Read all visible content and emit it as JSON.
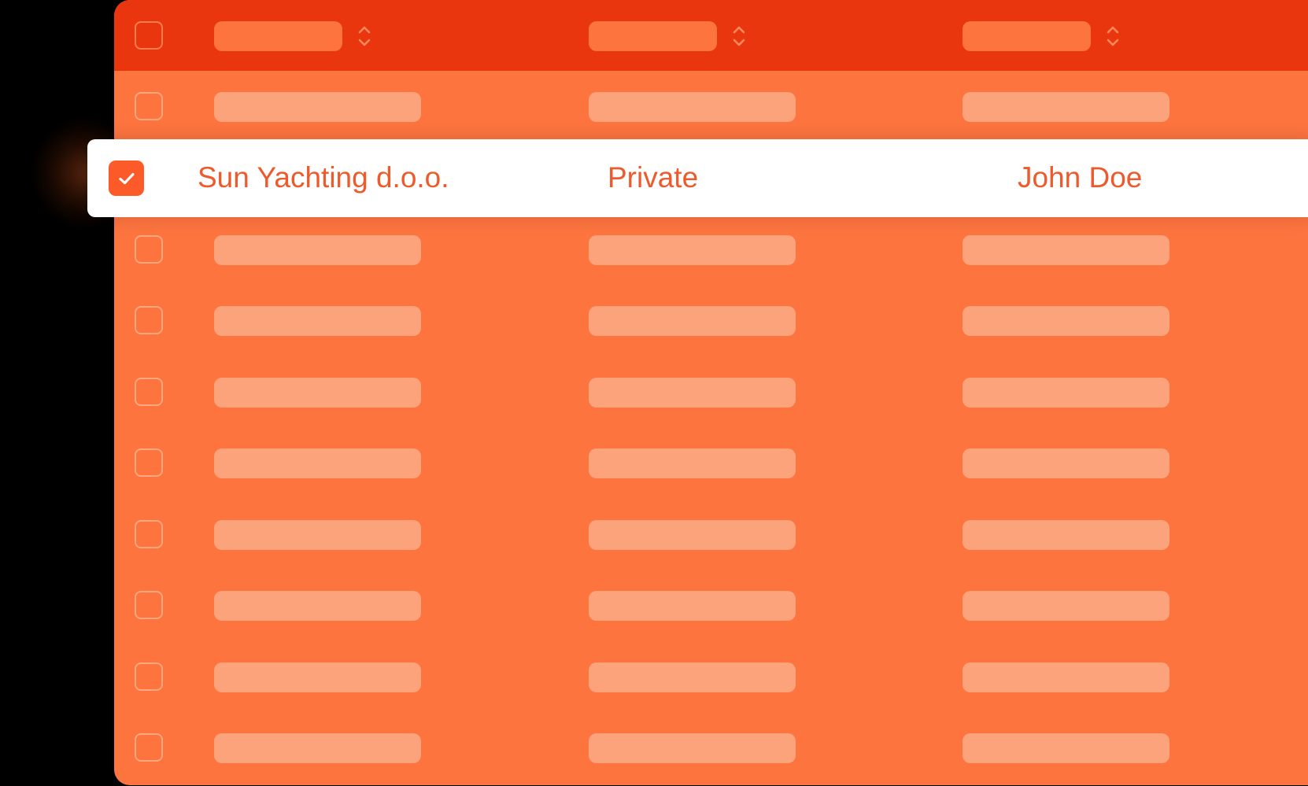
{
  "colors": {
    "background": "#000000",
    "header": "#ea360f",
    "table_body": "#fd743f",
    "placeholder": "#fda37c",
    "checkbox_border": "#ffa77e",
    "selected_row": "#ffffff",
    "accent": "#fd5a2a",
    "selected_text": "#ee5a2b"
  },
  "table": {
    "header": {
      "columns": [
        {
          "sort_icon": "sort-up-down-icon"
        },
        {
          "sort_icon": "sort-up-down-icon"
        },
        {
          "sort_icon": "sort-up-down-icon"
        }
      ]
    },
    "selected_row": {
      "checked": true,
      "company": "Sun Yachting d.o.o.",
      "type": "Private",
      "contact": "John Doe"
    },
    "placeholder_rows_before": 1,
    "placeholder_rows_after": 8
  }
}
